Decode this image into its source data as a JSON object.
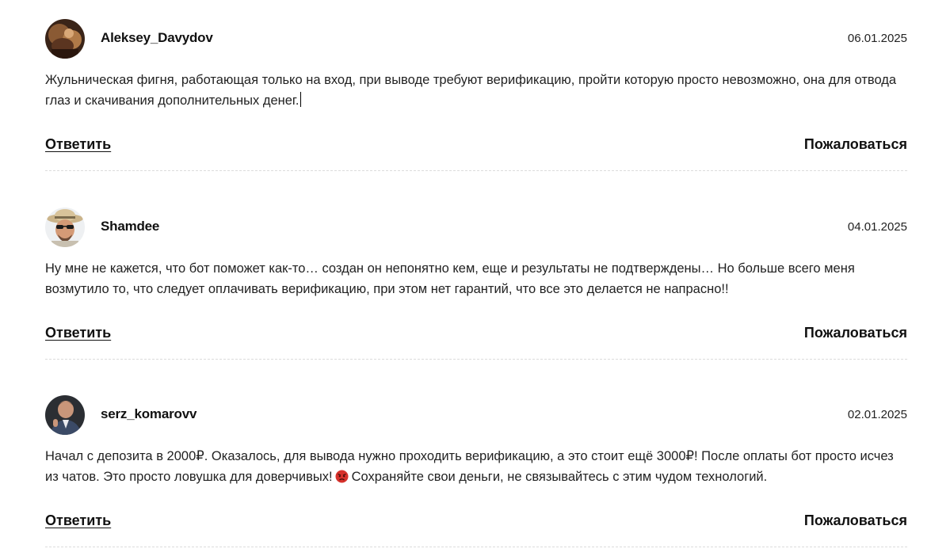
{
  "comments": [
    {
      "username": "Aleksey_Davydov",
      "date": "06.01.2025",
      "text": "Жульническая фигня, работающая только на вход, при выводе требуют верификацию, пройти которую просто невозможно, она для отвода глаз и скачивания дополнительных денег.",
      "reply_label": "Ответить",
      "report_label": "Пожаловаться",
      "avatar_icon": "user-photo-icon"
    },
    {
      "username": "Shamdee",
      "date": "04.01.2025",
      "text": "Ну мне не кажется, что бот поможет как-то… создан он непонятно кем, еще и результаты не подтверждены… Но больше всего меня возмутило то, что следует оплачивать верификацию, при этом нет гарантий, что все это делается не напрасно!!",
      "reply_label": "Ответить",
      "report_label": "Пожаловаться",
      "avatar_icon": "user-photo-icon"
    },
    {
      "username": "serz_komarovv",
      "date": "02.01.2025",
      "text_before_emoji": "Начал с депозита в 2000₽. Оказалось, для вывода нужно проходить верификацию, а это стоит ещё 3000₽! После оплаты бот просто исчез из чатов. Это просто ловушка для доверчивых!",
      "emoji_icon": "angry-face-emoji",
      "text_after_emoji": "Сохраняйте свои деньги, не связывайтесь с этим чудом технологий.",
      "reply_label": "Ответить",
      "report_label": "Пожаловаться",
      "avatar_icon": "user-photo-icon"
    }
  ],
  "colors": {
    "text": "#222222",
    "divider": "#dcdcdc",
    "emoji_red": "#d6312b"
  }
}
